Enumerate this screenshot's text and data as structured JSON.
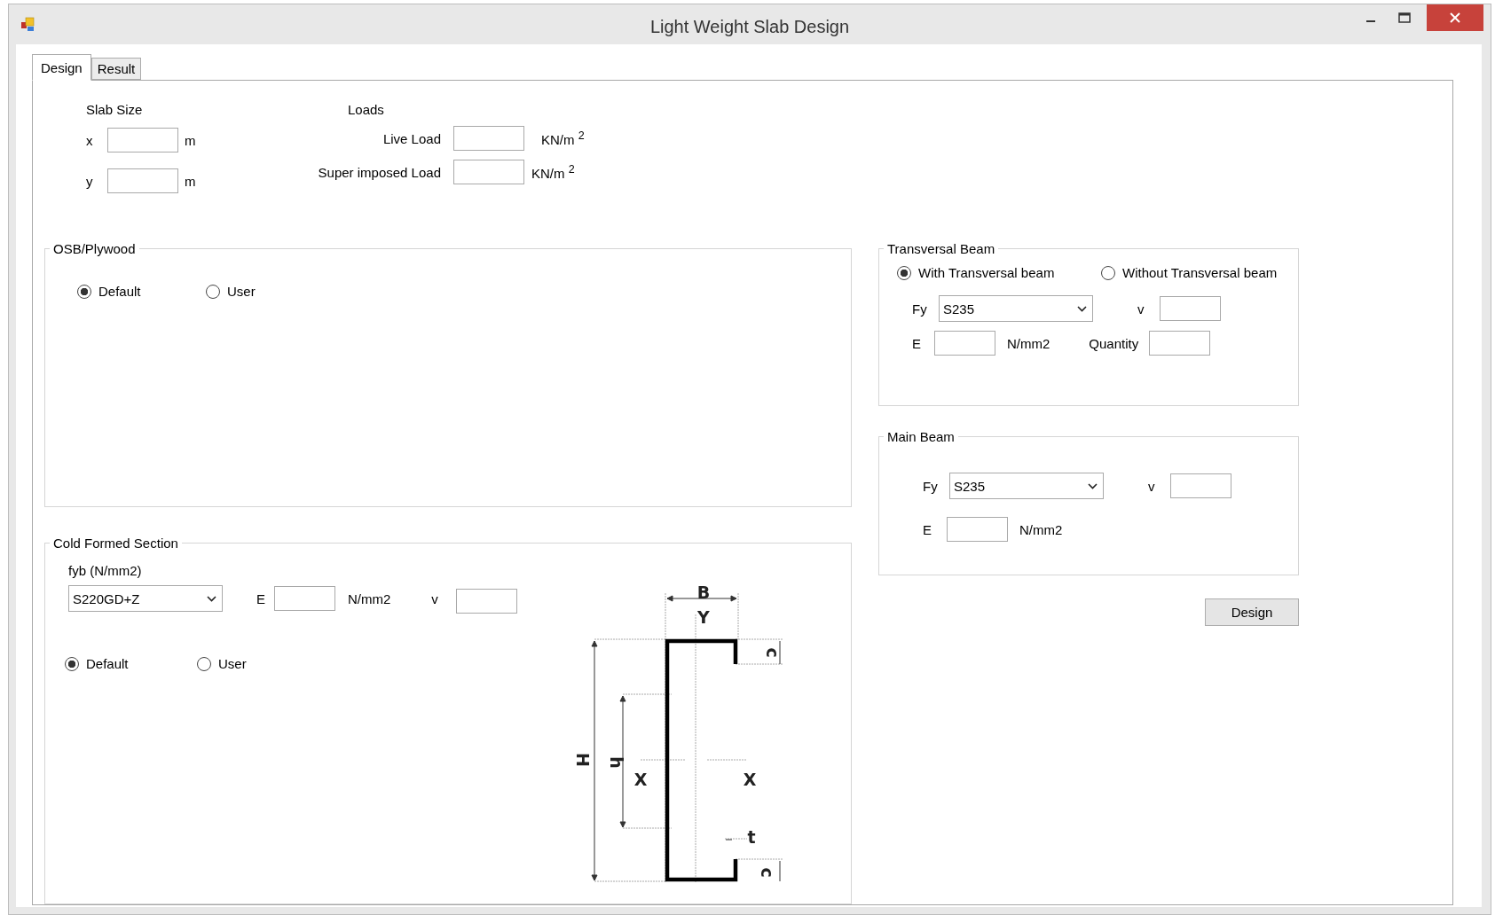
{
  "window": {
    "title": "Light Weight Slab Design"
  },
  "tabs": [
    {
      "label": "Design",
      "selected": true
    },
    {
      "label": "Result",
      "selected": false
    }
  ],
  "slab_size": {
    "title": "Slab Size",
    "fields": [
      {
        "label": "x",
        "unit": "m"
      },
      {
        "label": "y",
        "unit": "m"
      }
    ]
  },
  "loads": {
    "title": "Loads",
    "fields": [
      {
        "label": "Live Load",
        "unit": "KN/m $^{2}$"
      },
      {
        "label": "Super imposed Load",
        "unit": "KN/m $^{2}$"
      }
    ]
  },
  "osb_plywood": {
    "title": "OSB/Plywood",
    "options": [
      {
        "label": "Default",
        "selected": true
      },
      {
        "label": "User",
        "selected": false
      }
    ]
  },
  "cold_formed_section": {
    "title": "Cold Formed Section",
    "fyb_label": "fyb (N/mm2)",
    "fyb_value": "S220GD+Z",
    "e_label": "E",
    "e_unit": "N/mm2",
    "v_label": "v",
    "options": [
      {
        "label": "Default",
        "selected": true
      },
      {
        "label": "User",
        "selected": false
      }
    ],
    "drawing_labels": [
      "B",
      "Y",
      "c",
      "H",
      "h",
      "X",
      "X",
      "t",
      "c"
    ]
  },
  "transversal_beam": {
    "title": "Transversal Beam",
    "options": [
      {
        "label": "With Transversal beam",
        "selected": true
      },
      {
        "label": "Without Transversal beam",
        "selected": false
      }
    ],
    "fy_label": "Fy",
    "fy_value": "S235",
    "v_label": "v",
    "e_label": "E",
    "e_unit": "N/mm2",
    "quantity_label": "Quantity"
  },
  "main_beam": {
    "title": "Main Beam",
    "fy_label": "Fy",
    "fy_value": "S235",
    "v_label": "v",
    "e_label": "E",
    "e_unit": "N/mm2"
  },
  "design_button": "Design"
}
